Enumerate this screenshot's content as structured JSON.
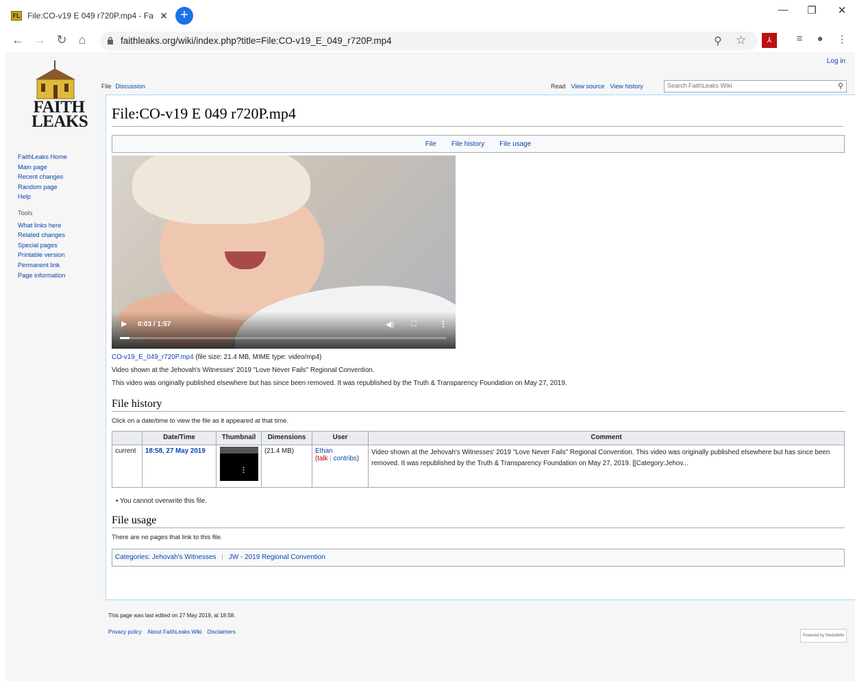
{
  "browser": {
    "tab_title": "File:CO-v19 E 049 r720P.mp4 - Fa",
    "favicon_text": "FL",
    "url": "faithleaks.org/wiki/index.php?title=File:CO-v19_E_049_r720P.mp4"
  },
  "site": {
    "login": "Log in",
    "logo_line1": "FAITH",
    "logo_line2": "LEAKS",
    "nav": [
      "FaithLeaks Home",
      "Main page",
      "Recent changes",
      "Random page",
      "Help"
    ],
    "tools_heading": "Tools",
    "tools": [
      "What links here",
      "Related changes",
      "Special pages",
      "Printable version",
      "Permanent link",
      "Page information"
    ],
    "tabs_left": [
      "File",
      "Discussion"
    ],
    "tabs_right": [
      "Read",
      "View source",
      "View history"
    ],
    "search_placeholder": "Search FaithLeaks Wiki"
  },
  "page": {
    "title": "File:CO-v19 E 049 r720P.mp4",
    "toc": [
      "File",
      "File history",
      "File usage"
    ],
    "video": {
      "time": "0:03 / 1:57",
      "progress": 0.03
    },
    "file_link": "CO-v19_E_049_r720P.mp4",
    "file_meta": "(file size: 21.4 MB, MIME type: video/mp4)",
    "desc1": "Video shown at the Jehovah's Witnesses' 2019 \"Love Never Fails\" Regional Convention.",
    "desc2": "This video was originally published elsewhere but has since been removed. It was republished by the Truth & Transparency Foundation on May 27, 2019.",
    "history_heading": "File history",
    "history_hint": "Click on a date/time to view the file as it appeared at that time.",
    "history_headers": [
      "",
      "Date/Time",
      "Thumbnail",
      "Dimensions",
      "User",
      "Comment"
    ],
    "history_row": {
      "status": "current",
      "datetime": "18:58, 27 May 2019",
      "dimensions": "(21.4 MB)",
      "user": "Ethan",
      "talk": "talk",
      "contribs": "contribs",
      "comment": "Video shown at the Jehovah's Witnesses' 2019 \"Love Never Fails\" Regional Convention. This video was originally published elsewhere but has since been removed. It was republished by the Truth & Transparency Foundation on May 27, 2019. [[Category:Jehov..."
    },
    "overwrite_note": "You cannot overwrite this file.",
    "usage_heading": "File usage",
    "usage_text": "There are no pages that link to this file.",
    "categories_label": "Categories",
    "categories": [
      "Jehovah's Witnesses",
      "JW - 2019 Regional Convention"
    ]
  },
  "footer": {
    "last_edited": "This page was last edited on 27 May 2019, at 18:58.",
    "links": [
      "Privacy policy",
      "About FaithLeaks Wiki",
      "Disclaimers"
    ],
    "powered": "Powered by MediaWiki"
  }
}
